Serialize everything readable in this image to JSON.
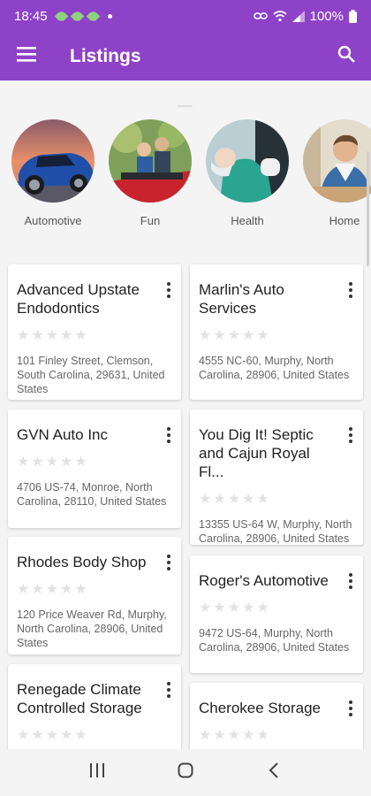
{
  "status_bar": {
    "time": "18:45",
    "battery": "100%"
  },
  "app_bar": {
    "title": "Listings"
  },
  "categories": [
    {
      "label": "Automotive",
      "icon": "car-photo"
    },
    {
      "label": "Fun",
      "icon": "rollercoaster-photo"
    },
    {
      "label": "Health",
      "icon": "doctor-photo"
    },
    {
      "label": "Home",
      "icon": "carpenter-photo"
    }
  ],
  "listings": [
    {
      "name": "Advanced Upstate Endodontics",
      "address": "101 Finley Street, Clemson, South Carolina, 29631, United States",
      "rating": 0
    },
    {
      "name": "Marlin's Auto Services",
      "address": "4555 NC-60, Murphy, North Carolina, 28906, United States",
      "rating": 0
    },
    {
      "name": "GVN Auto Inc",
      "address": "4706 US-74, Monroe, North Carolina, 28110, United States",
      "rating": 0
    },
    {
      "name": "You Dig It! Septic and Cajun Royal Fl...",
      "address": "13355 US-64 W, Murphy, North Carolina, 28906, United States",
      "rating": 0
    },
    {
      "name": "Rhodes Body Shop",
      "address": "120 Price Weaver Rd, Murphy, North Carolina, 28906, United States",
      "rating": 0
    },
    {
      "name": "Roger's Automotive",
      "address": "9472 US-64, Murphy, North Carolina, 28906, United States",
      "rating": 0
    },
    {
      "name": "Renegade Climate Controlled Storage",
      "address": "",
      "rating": 0
    },
    {
      "name": "Cherokee Storage",
      "address": "",
      "rating": 0
    }
  ],
  "theme": {
    "primary": "#8e42c8",
    "star_empty": "#e2e2e2"
  }
}
